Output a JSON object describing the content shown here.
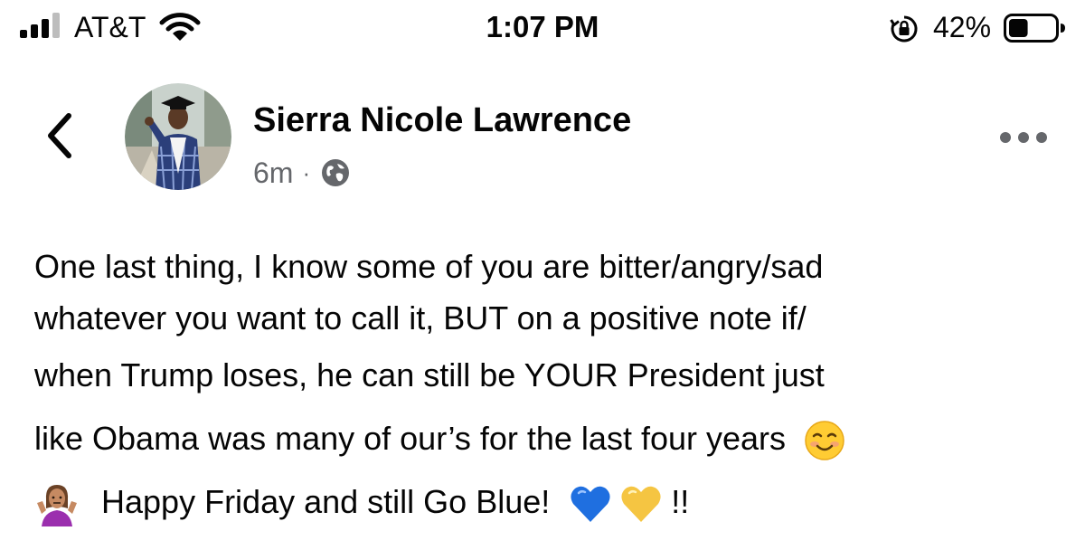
{
  "status_bar": {
    "carrier": "AT&T",
    "time": "1:07 PM",
    "battery_percent": "42%",
    "battery_level": 0.42,
    "icons": [
      "signal-bars-icon",
      "wifi-icon",
      "orientation-lock-icon",
      "battery-icon"
    ]
  },
  "post": {
    "back_icon": "chevron-left-icon",
    "more_icon": "more-horizontal-icon",
    "author": "Sierra Nicole Lawrence",
    "time_ago": "6m",
    "separator": "·",
    "privacy_icon": "globe-icon",
    "lines": [
      "One last thing, I know some of you are bitter/angry/sad",
      "whatever you want to call it, BUT on a positive note if/",
      "when Trump loses, he can still be YOUR President just",
      "like Obama was many of our’s for the last four years"
    ],
    "line_5_text": "Happy Friday and still Go Blue!",
    "line_5_end": "!!",
    "emojis": [
      "smiling-face-emoji",
      "person-shrugging-emoji",
      "blue-heart-emoji",
      "yellow-heart-emoji"
    ],
    "colors": {
      "text": "#050505",
      "meta": "#65676b",
      "blue_heart": "#1f6fe0",
      "yellow_heart": "#f5c542",
      "shrug_shirt": "#9b2fae"
    }
  }
}
